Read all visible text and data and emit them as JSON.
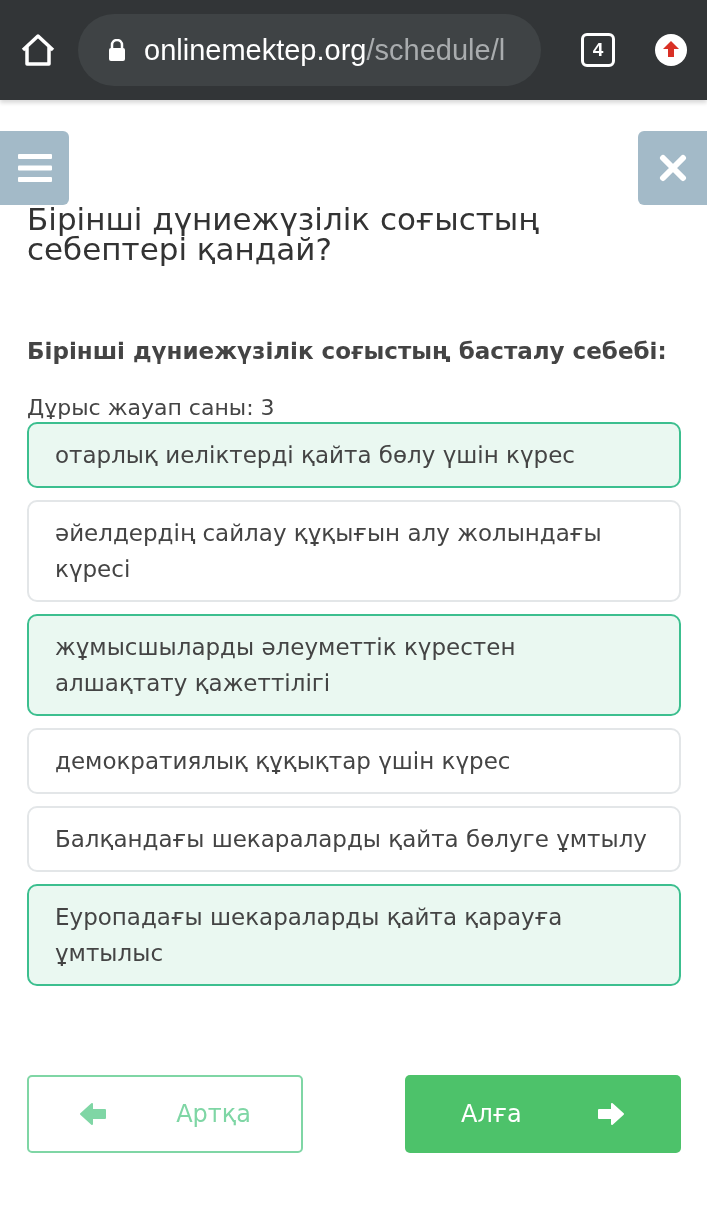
{
  "browser": {
    "url_host": "onlinemektep.org",
    "url_path": "/schedule/l",
    "tab_count": "4"
  },
  "title": "Бірінші дүниежүзілік соғыстың себептері қандай?",
  "question": "Бірінші дүниежүзілік соғыстың басталу себебі:",
  "answer_count": "Дұрыс жауап саны: 3",
  "options": [
    {
      "text": "отарлық иеліктерді қайта бөлу үшін күрес",
      "selected": true
    },
    {
      "text": "әйелдердің сайлау құқығын алу жолындағы күресі",
      "selected": false
    },
    {
      "text": "жұмысшыларды әлеуметтік күрестен алшақтату қажеттілігі",
      "selected": true
    },
    {
      "text": "демократиялық құқықтар үшін күрес",
      "selected": false
    },
    {
      "text": "Балқандағы шекараларды қайта бөлуге ұмтылу",
      "selected": false
    },
    {
      "text": "Еуропадағы шекараларды қайта қарауға ұмтылыс",
      "selected": true
    }
  ],
  "nav": [
    {
      "kind": "back",
      "label": "Артқа"
    },
    {
      "kind": "next",
      "label": "Алға"
    }
  ]
}
